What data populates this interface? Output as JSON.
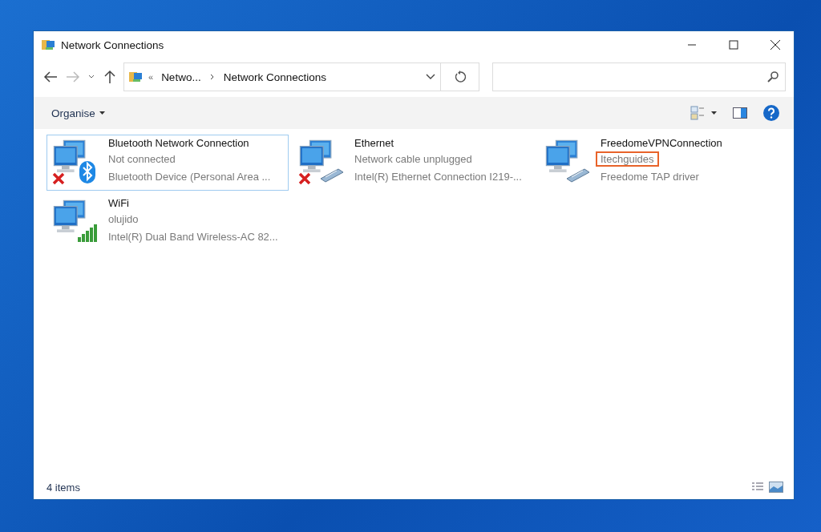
{
  "window": {
    "title": "Network Connections"
  },
  "address_bar": {
    "overflow": "«",
    "crumbs": [
      "Netwo...",
      "Network Connections"
    ]
  },
  "toolbar": {
    "organise": "Organise"
  },
  "connections": [
    {
      "name": "Bluetooth Network Connection",
      "status": "Not connected",
      "device": "Bluetooth Device (Personal Area ...",
      "kind": "bluetooth",
      "disconnected": true,
      "selected": true,
      "status_highlighted": false
    },
    {
      "name": "Ethernet",
      "status": "Network cable unplugged",
      "device": "Intel(R) Ethernet Connection I219-...",
      "kind": "ethernet",
      "disconnected": true,
      "selected": false,
      "status_highlighted": false
    },
    {
      "name": "FreedomeVPNConnection",
      "status": "Itechguides",
      "device": "Freedome TAP driver",
      "kind": "ethernet",
      "disconnected": false,
      "selected": false,
      "status_highlighted": true
    },
    {
      "name": "WiFi",
      "status": "olujido",
      "device": "Intel(R) Dual Band Wireless-AC 82...",
      "kind": "wifi",
      "disconnected": false,
      "selected": false,
      "status_highlighted": false
    }
  ],
  "status_bar": {
    "count": "4 items"
  }
}
